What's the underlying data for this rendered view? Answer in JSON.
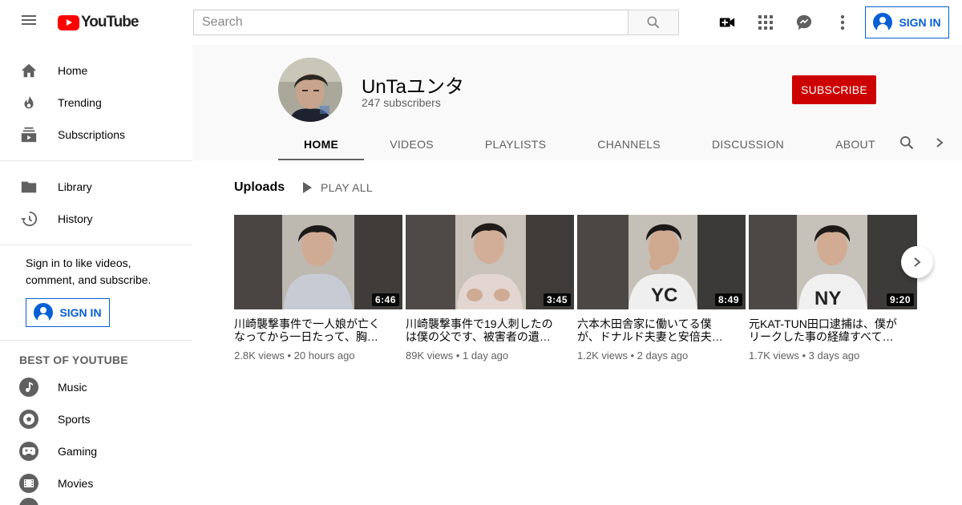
{
  "header": {
    "logo_text": "YouTube",
    "search_placeholder": "Search",
    "signin_label": "SIGN IN",
    "icons": [
      "menu-icon",
      "search-icon",
      "video-camera-icon",
      "apps-icon",
      "messages-icon",
      "more-vert-icon"
    ]
  },
  "sidebar": {
    "main": [
      {
        "label": "Home",
        "icon": "home-icon"
      },
      {
        "label": "Trending",
        "icon": "trending-icon"
      },
      {
        "label": "Subscriptions",
        "icon": "subscriptions-icon"
      }
    ],
    "library": [
      {
        "label": "Library",
        "icon": "folder-icon"
      },
      {
        "label": "History",
        "icon": "history-icon"
      }
    ],
    "signin_text": "Sign in to like videos, comment, and subscribe.",
    "signin_label": "SIGN IN",
    "best_heading": "BEST OF YOUTUBE",
    "best": [
      {
        "label": "Music",
        "icon": "music-icon"
      },
      {
        "label": "Sports",
        "icon": "sports-icon"
      },
      {
        "label": "Gaming",
        "icon": "gaming-icon"
      },
      {
        "label": "Movies",
        "icon": "movies-icon"
      }
    ]
  },
  "channel": {
    "name": "UnTaユンタ",
    "subscribers": "247 subscribers",
    "subscribe_label": "SUBSCRIBE",
    "tabs": [
      "HOME",
      "VIDEOS",
      "PLAYLISTS",
      "CHANNELS",
      "DISCUSSION",
      "ABOUT"
    ],
    "active_tab": "HOME"
  },
  "uploads": {
    "title": "Uploads",
    "play_all_label": "PLAY ALL",
    "videos": [
      {
        "title": "川崎襲撃事件で一人娘が亡くなってから一日たって、胸…",
        "duration": "6:46",
        "views": "2.8K views",
        "age": "20 hours ago"
      },
      {
        "title": "川崎襲撃事件で19人刺したのは僕の父です、被害者の遺…",
        "duration": "3:45",
        "views": "89K views",
        "age": "1 day ago"
      },
      {
        "title": "六本木田舎家に働いてる僕が、ドナルド夫妻と安倍夫…",
        "duration": "8:49",
        "views": "1.2K views",
        "age": "2 days ago"
      },
      {
        "title": "元KAT-TUN田口逮捕は、僕がリークした事の経緯すべて…",
        "duration": "9:20",
        "views": "1.7K views",
        "age": "3 days ago"
      }
    ]
  },
  "colors": {
    "brand_red": "#ff0000",
    "subscribe_red": "#cc0000",
    "link_blue": "#065fd4",
    "text_secondary": "#606060"
  }
}
